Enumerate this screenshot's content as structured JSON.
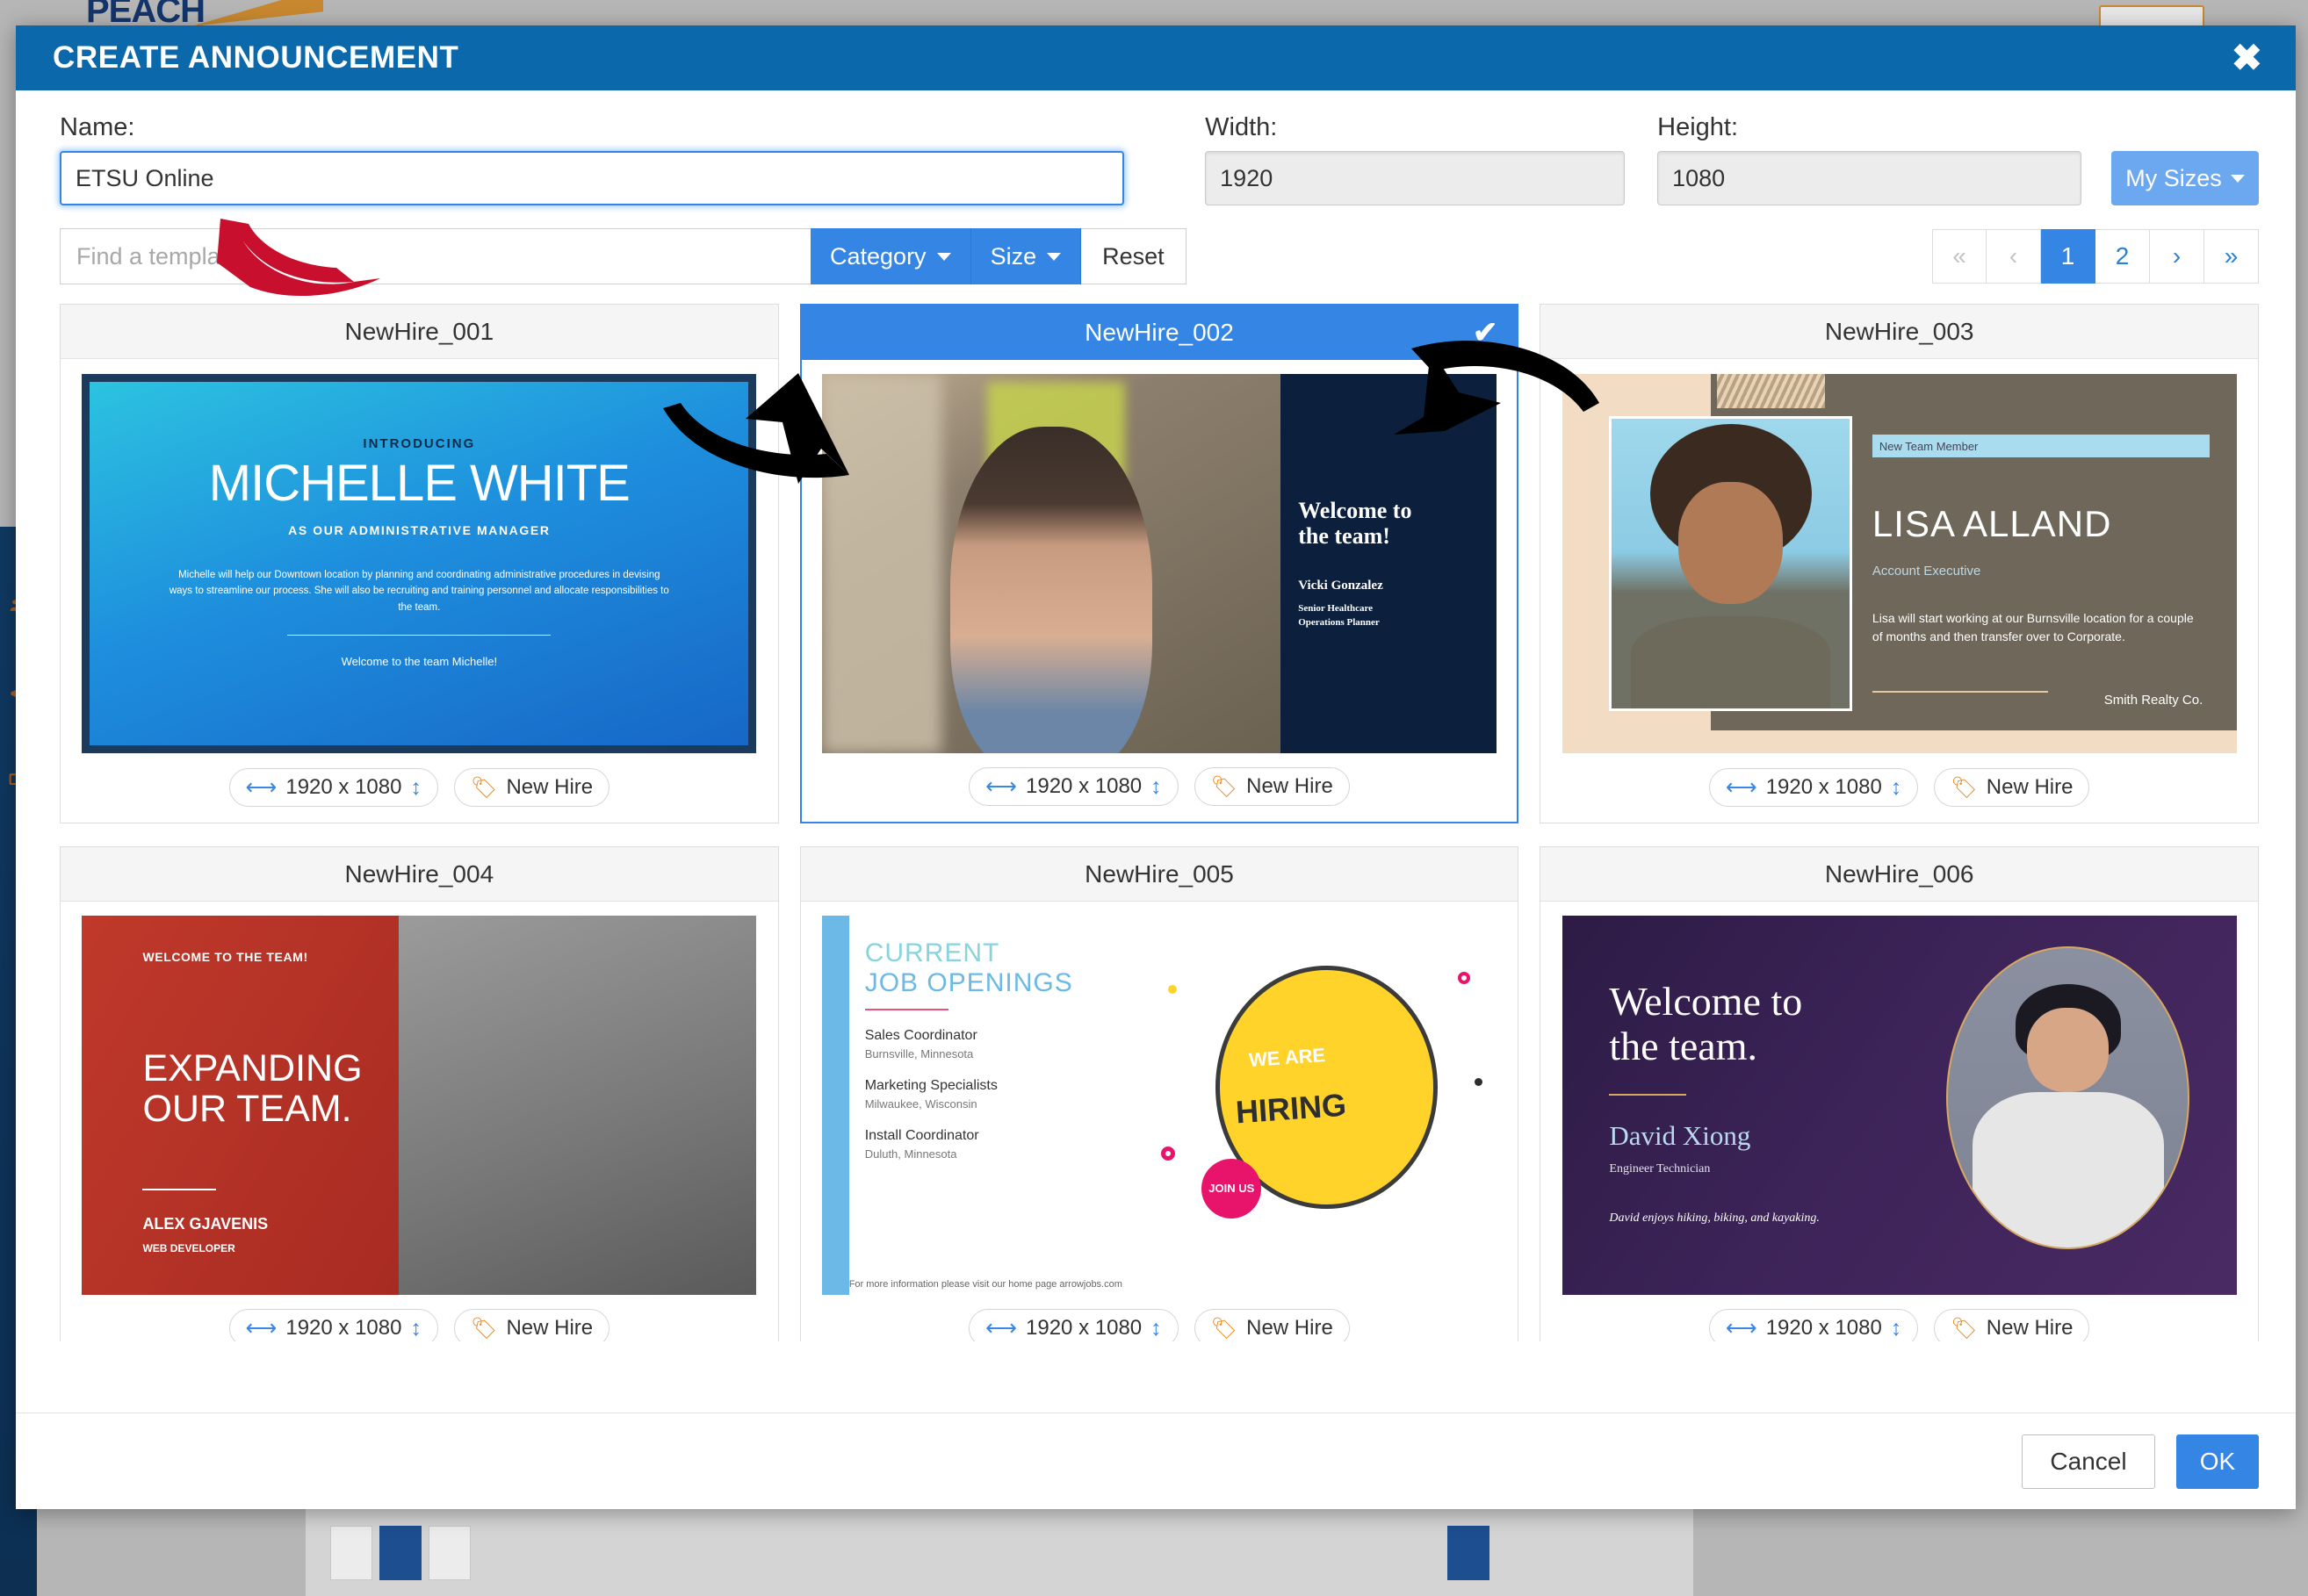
{
  "background": {
    "logo_text": "PEACH",
    "sidebar_icons": [
      "users-icon",
      "megaphone-icon",
      "display-icon"
    ]
  },
  "modal": {
    "title": "CREATE ANNOUNCEMENT",
    "close_icon": "close-icon",
    "fields": {
      "name_label": "Name:",
      "name_value": "ETSU Online",
      "width_label": "Width:",
      "width_value": "1920",
      "height_label": "Height:",
      "height_value": "1080",
      "my_sizes_label": "My Sizes"
    },
    "toolbar": {
      "search_placeholder": "Find a template",
      "search_value": "",
      "category_label": "Category",
      "size_label": "Size",
      "reset_label": "Reset"
    },
    "pagination": {
      "first": "«",
      "prev": "‹",
      "pages": [
        "1",
        "2"
      ],
      "active_page": "1",
      "next": "›",
      "last": "»"
    },
    "footer": {
      "cancel_label": "Cancel",
      "ok_label": "OK"
    }
  },
  "templates": [
    {
      "name": "NewHire_001",
      "selected": false,
      "size_badge": "1920 x 1080",
      "tag_badge": "New Hire",
      "poster": {
        "kind": "introducing-blue",
        "eyebrow": "INTRODUCING",
        "name": "MICHELLE WHITE",
        "role": "AS OUR ADMINISTRATIVE MANAGER",
        "body": "Michelle will help our Downtown location by planning and coordinating administrative procedures in devising ways to streamline our process. She will also be recruiting and training personnel and allocate responsibilities to the team.",
        "closing": "Welcome to the team Michelle!"
      }
    },
    {
      "name": "NewHire_002",
      "selected": true,
      "size_badge": "1920 x 1080",
      "tag_badge": "New Hire",
      "poster": {
        "kind": "photo-navy",
        "headline": "Welcome to\nthe team!",
        "name": "Vicki Gonzalez",
        "role": "Senior Healthcare\nOperations Planner"
      }
    },
    {
      "name": "NewHire_003",
      "selected": false,
      "size_badge": "1920 x 1080",
      "tag_badge": "New Hire",
      "poster": {
        "kind": "tan-brown",
        "eyebrow": "New Team Member",
        "name": "LISA ALLAND",
        "role": "Account Executive",
        "body": "Lisa will start working at our Burnsville location for a couple of months and then transfer over to Corporate.",
        "company": "Smith Realty Co."
      }
    },
    {
      "name": "NewHire_004",
      "selected": false,
      "size_badge": "1920 x 1080",
      "tag_badge": "New Hire",
      "poster": {
        "kind": "red-grey",
        "eyebrow": "WELCOME TO THE TEAM!",
        "headline": "EXPANDING\nOUR TEAM.",
        "name": "ALEX GJAVENIS",
        "role": "WEB DEVELOPER"
      }
    },
    {
      "name": "NewHire_005",
      "selected": false,
      "size_badge": "1920 x 1080",
      "tag_badge": "New Hire",
      "poster": {
        "kind": "job-openings",
        "title_line1": "CURRENT",
        "title_line2": "JOB OPENINGS",
        "jobs": [
          {
            "title": "Sales Coordinator",
            "location": "Burnsville, Minnesota"
          },
          {
            "title": "Marketing Specialists",
            "location": "Milwaukee, Wisconsin"
          },
          {
            "title": "Install Coordinator",
            "location": "Duluth, Minnesota"
          }
        ],
        "footer": "For more information please visit our home page arrowjobs.com",
        "bubble_line1": "WE ARE",
        "bubble_line2": "HIRING",
        "bubble_badge": "JOIN US"
      }
    },
    {
      "name": "NewHire_006",
      "selected": false,
      "size_badge": "1920 x 1080",
      "tag_badge": "New Hire",
      "poster": {
        "kind": "purple-oval",
        "headline": "Welcome to\nthe team.",
        "name": "David Xiong",
        "role": "Engineer Technician",
        "bio": "David enjoys hiking, biking, and kayaking."
      }
    }
  ],
  "annotations": [
    {
      "name": "red-arrow-to-name-field",
      "color": "#c8102e"
    },
    {
      "name": "black-arrow-to-category-button",
      "color": "#000000"
    },
    {
      "name": "black-arrow-to-selected-template",
      "color": "#000000"
    }
  ]
}
